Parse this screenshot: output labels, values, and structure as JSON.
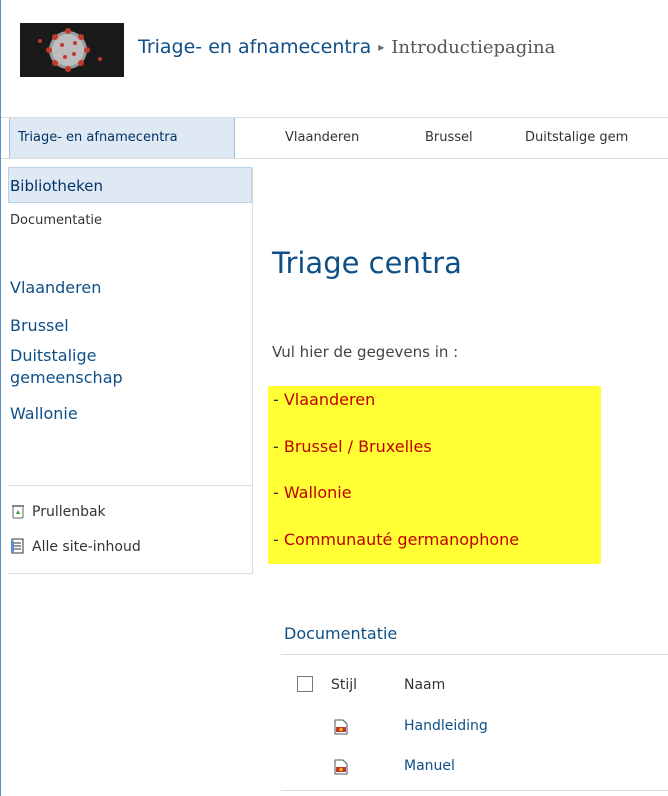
{
  "header": {
    "site_title": "Triage- en afnamecentra",
    "separator": "▸",
    "page_title": "Introductiepagina"
  },
  "topnav": {
    "tabs": [
      {
        "label": "Triage- en afnamecentra",
        "selected": true
      },
      {
        "label": "Vlaanderen",
        "selected": false
      },
      {
        "label": "Brussel",
        "selected": false
      },
      {
        "label": "Duitstalige gem",
        "selected": false
      }
    ]
  },
  "leftnav": {
    "heading": "Bibliotheken",
    "sub_item": "Documentatie",
    "links": [
      "Vlaanderen",
      "Brussel",
      "Duitstalige gemeenschap",
      "Wallonie"
    ],
    "recycle_bin": "Prullenbak",
    "all_content": "Alle site-inhoud"
  },
  "main": {
    "title": "Triage centra",
    "intro": "Vul hier de gegevens in :",
    "regions": [
      {
        "prefix": "- ",
        "label": "Vlaanderen"
      },
      {
        "prefix": "- ",
        "label": "Brussel / Bruxelles"
      },
      {
        "prefix": "- ",
        "label": "Wallonie"
      },
      {
        "prefix": "- ",
        "label": "Communauté germanophone"
      }
    ]
  },
  "library": {
    "title": "Documentatie",
    "columns": {
      "type": "Stijl",
      "name": "Naam"
    },
    "documents": [
      {
        "icon": "pdf-document-icon",
        "name": "Handleiding"
      },
      {
        "icon": "pdf-document-icon",
        "name": "Manuel"
      }
    ]
  },
  "colors": {
    "link": "#0f4f88",
    "highlight": "#ffff33",
    "region_text": "#c00000",
    "selected_bg": "#dfe9f4"
  }
}
